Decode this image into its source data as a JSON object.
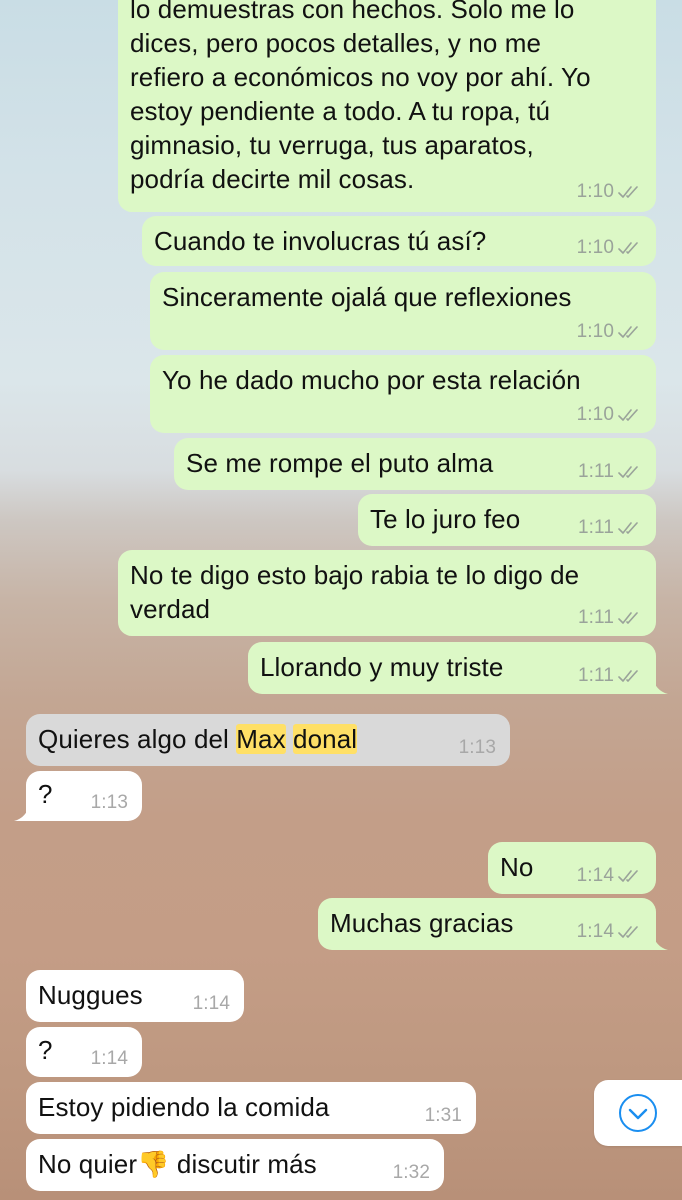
{
  "colors": {
    "outgoing_bubble": "#dcf8c6",
    "incoming_bubble": "#ffffff",
    "selected_bubble": "#d9d9d9",
    "highlight": "#ffe066",
    "accent_blue": "#1a8ef0",
    "tick_color": "#9aa39a"
  },
  "messages": [
    {
      "dir": "out",
      "lines": [
        "lo demuestras con hechos. Solo me lo",
        "dices, pero pocos detalles, y no me",
        "refiero a económicos no voy por ahí. Yo",
        "estoy pendiente a todo. A tu ropa, tú",
        "gimnasio, tu verruga, tus aparatos,",
        "podría decirte mil cosas."
      ],
      "time": "1:10"
    },
    {
      "dir": "out",
      "text": "Cuando te involucras tú así?",
      "time": "1:10"
    },
    {
      "dir": "out",
      "text": "Sinceramente ojalá que reflexiones",
      "time": "1:10"
    },
    {
      "dir": "out",
      "text": "Yo he dado mucho por esta relación",
      "time": "1:10"
    },
    {
      "dir": "out",
      "text": "Se me rompe el puto alma",
      "time": "1:11"
    },
    {
      "dir": "out",
      "text": "Te lo juro feo",
      "time": "1:11"
    },
    {
      "dir": "out",
      "lines": [
        "No te digo esto bajo rabia te lo digo de",
        "verdad"
      ],
      "time": "1:11"
    },
    {
      "dir": "out",
      "text": "Llorando y muy triste",
      "time": "1:11"
    },
    {
      "dir": "in",
      "prefix": "Quieres algo del ",
      "hl1": "Max",
      "sep": " ",
      "hl2": "donal",
      "time": "1:13"
    },
    {
      "dir": "in",
      "text": "?",
      "time": "1:13"
    },
    {
      "dir": "out",
      "text": "No",
      "time": "1:14"
    },
    {
      "dir": "out",
      "text": "Muchas gracias",
      "time": "1:14"
    },
    {
      "dir": "in",
      "text": "Nuggues",
      "time": "1:14"
    },
    {
      "dir": "in",
      "text": "?",
      "time": "1:14"
    },
    {
      "dir": "in",
      "text": "Estoy pidiendo la comida",
      "time": "1:31"
    },
    {
      "dir": "in",
      "before": "No quier",
      "emoji": "👎",
      "after": " discutir más",
      "time": "1:32"
    }
  ],
  "scroll_button": {
    "icon": "chevron-down-circle-icon"
  }
}
